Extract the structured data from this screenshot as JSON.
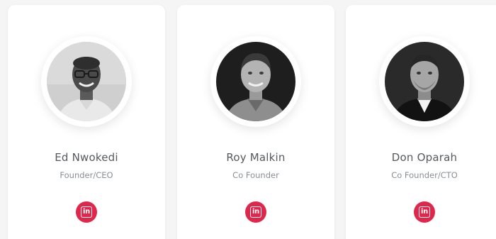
{
  "team": [
    {
      "name": "Ed Nwokedi",
      "role": "Founder/CEO",
      "social_icon": "linkedin-icon",
      "social_glyph": "in"
    },
    {
      "name": "Roy Malkin",
      "role": "Co Founder",
      "social_icon": "linkedin-icon",
      "social_glyph": "in"
    },
    {
      "name": "Don Oparah",
      "role": "Co Founder/CTO",
      "social_icon": "linkedin-icon",
      "social_glyph": "in"
    }
  ],
  "colors": {
    "accent": "#e0264a",
    "card_bg": "#ffffff",
    "page_bg": "#f5f5f6",
    "name_text": "#555a60",
    "role_text": "#8a8f95"
  }
}
